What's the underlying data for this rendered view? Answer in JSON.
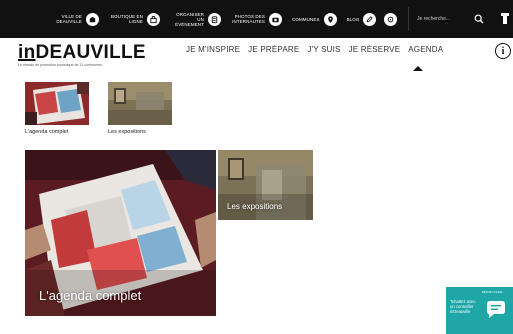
{
  "topbar": {
    "items": [
      {
        "label": "VILLE DE DEAUVILLE",
        "icon": "city-icon"
      },
      {
        "label": "BOUTIQUE EN LIGNE",
        "icon": "shop-icon"
      },
      {
        "label": "ORGANISER UN ÉVÉNEMENT",
        "icon": "event-icon"
      },
      {
        "label": "PHOTOS DES INTERNAUTES",
        "icon": "camera-icon"
      },
      {
        "label": "COMMUNES",
        "icon": "location-pin-icon"
      },
      {
        "label": "BLOG",
        "icon": "blog-icon"
      }
    ],
    "search_placeholder": "Je recherche..."
  },
  "logo": {
    "prefix": "in",
    "name": "DEAUVILLE",
    "tagline": "Le réseau de promotion touristique de 11 communes"
  },
  "nav": {
    "items": [
      "JE M'INSPIRE",
      "JE PRÉPARE",
      "J'Y SUIS",
      "JE RÉSERVE",
      "AGENDA"
    ],
    "active": "AGENDA"
  },
  "info_label": "i",
  "thumbnails": [
    {
      "caption": "L'agenda complet"
    },
    {
      "caption": "Les expositions"
    }
  ],
  "tiles": [
    {
      "label": "L'agenda complet"
    },
    {
      "label": "Les expositions"
    }
  ],
  "chat": {
    "top": "BESOIN D'AIDE",
    "text": "Tchattez avec un conseiller inDeauville"
  },
  "colors": {
    "topbar": "#111111",
    "chat": "#1fa6a6"
  }
}
